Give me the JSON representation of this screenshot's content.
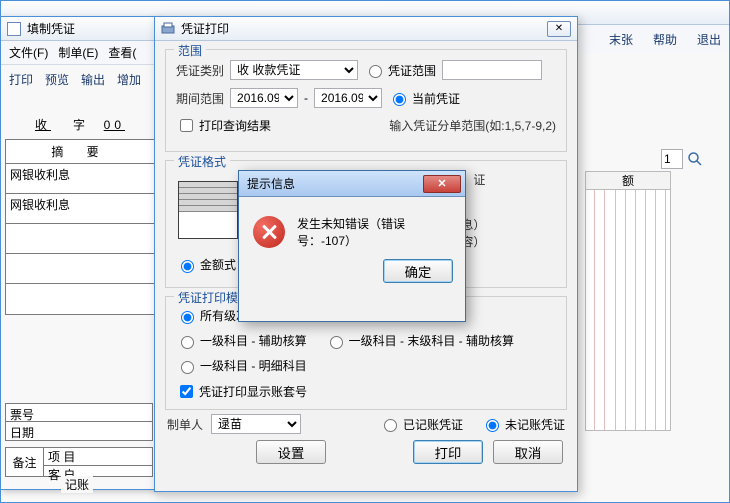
{
  "bg": {
    "tools": {
      "last": "末张",
      "help": "帮助",
      "exit": "退出"
    },
    "page_value": "1",
    "grid_header": "额"
  },
  "entry": {
    "title": "填制凭证",
    "menu": {
      "file": "文件(F)",
      "make": "制单(E)",
      "view": "查看("
    },
    "tools": {
      "print": "打印",
      "preview": "预览",
      "output": "输出",
      "add": "增加"
    },
    "shou": "收",
    "zi": "字",
    "num": "00",
    "summary_header": "摘 要",
    "row1": "网银收利息",
    "row2": "网银收利息",
    "ticket_label": "票号",
    "date_label": "日期",
    "remark_label": "备注",
    "item_label": "项 目",
    "cust_label": "客 户",
    "jz": "记账"
  },
  "print": {
    "title": "凭证打印",
    "group_range": "范围",
    "voucher_type_label": "凭证类别",
    "voucher_type_value": "收 收款凭证",
    "period_label": "期间范围",
    "period_from": "2016.09",
    "period_to": "2016.09",
    "range_radio": "凭证范围",
    "current_radio": "当前凭证",
    "print_query_chk": "打印查询结果",
    "hint": "输入凭证分单范围(如:1,5,7-9,2)",
    "group_format": "凭证格式",
    "radio_amount": "金额式",
    "cert_suffix": "证",
    "info1": "信息）",
    "info2": "要内容）",
    "group_template": "凭证打印模",
    "tpl_all": "所有级次",
    "tpl_l1aux": "一级科目 - 辅助核算",
    "tpl_l1lastaux": "一级科目 - 末级科目 - 辅助核算",
    "tpl_l1detail": "一级科目 - 明细科目",
    "show_book_chk": "凭证打印显示账套号",
    "maker_label": "制单人",
    "maker_value": "逯苗",
    "posted_radio": "已记账凭证",
    "unposted_radio": "未记账凭证",
    "btn_settings": "设置",
    "btn_print": "打印",
    "btn_cancel": "取消"
  },
  "err": {
    "title": "提示信息",
    "message": "发生未知错误（错误号：-107）",
    "btn_ok": "确定"
  }
}
